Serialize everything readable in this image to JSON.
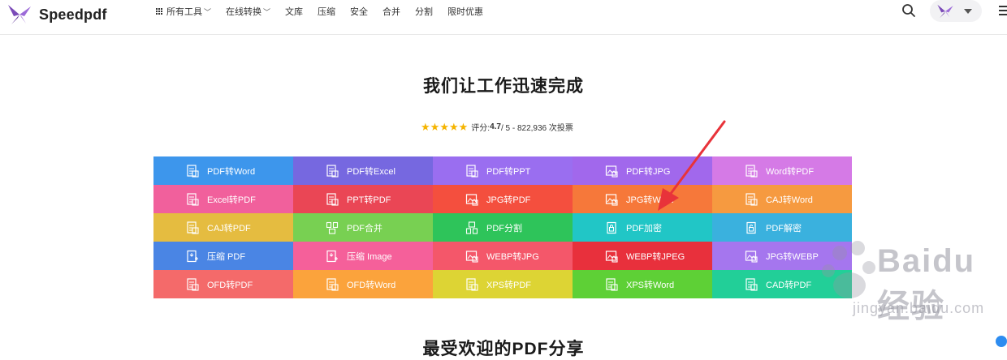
{
  "header": {
    "brand": "Speedpdf",
    "nav": [
      {
        "label": "所有工具",
        "has_grid_icon": true,
        "has_chevron": true
      },
      {
        "label": "在线转换",
        "has_chevron": true
      },
      {
        "label": "文库"
      },
      {
        "label": "压缩"
      },
      {
        "label": "安全"
      },
      {
        "label": "合并"
      },
      {
        "label": "分割"
      },
      {
        "label": "限时优惠"
      }
    ],
    "icons": [
      "search-icon",
      "avatar",
      "caret-down-icon",
      "menu-icon"
    ]
  },
  "hero": {
    "title": "我们让工作迅速完成",
    "rating_prefix": "评分: ",
    "rating_value": "4.7",
    "rating_suffix": " / 5 - 822,936 次投票",
    "stars": 5,
    "star_color": "#f5b400"
  },
  "tools": [
    {
      "label": "PDF转Word",
      "color": "#3d96ec",
      "icon": "document-icon"
    },
    {
      "label": "PDF转Excel",
      "color": "#7668e0",
      "icon": "document-icon"
    },
    {
      "label": "PDF转PPT",
      "color": "#9a6ef0",
      "icon": "document-icon"
    },
    {
      "label": "PDF转JPG",
      "color": "#a168ec",
      "icon": "image-icon"
    },
    {
      "label": "Word转PDF",
      "color": "#d57ae6",
      "icon": "document-icon"
    },
    {
      "label": "Excel转PDF",
      "color": "#f1609c",
      "icon": "document-icon"
    },
    {
      "label": "PPT转PDF",
      "color": "#ea4655",
      "icon": "document-icon"
    },
    {
      "label": "JPG转PDF",
      "color": "#f44f3e",
      "icon": "image-icon"
    },
    {
      "label": "JPG转Word",
      "color": "#f6783a",
      "icon": "image-icon"
    },
    {
      "label": "CAJ转Word",
      "color": "#f69a40",
      "icon": "document-icon"
    },
    {
      "label": "CAJ转PDF",
      "color": "#e5bc40",
      "icon": "document-icon"
    },
    {
      "label": "PDF合并",
      "color": "#78d052",
      "icon": "merge-icon"
    },
    {
      "label": "PDF分割",
      "color": "#2ec45a",
      "icon": "split-icon"
    },
    {
      "label": "PDF加密",
      "color": "#21c6c6",
      "icon": "lock-icon"
    },
    {
      "label": "PDF解密",
      "color": "#3ab1de",
      "icon": "unlock-icon"
    },
    {
      "label": "压缩 PDF",
      "color": "#4a85e4",
      "icon": "compress-icon"
    },
    {
      "label": "压缩 Image",
      "color": "#f5609a",
      "icon": "compress-icon"
    },
    {
      "label": "WEBP转JPG",
      "color": "#f4576a",
      "icon": "image-icon"
    },
    {
      "label": "WEBP转JPEG",
      "color": "#e8303c",
      "icon": "image-icon"
    },
    {
      "label": "JPG转WEBP",
      "color": "#a576ee",
      "icon": "image-icon"
    },
    {
      "label": "OFD转PDF",
      "color": "#f46a6a",
      "icon": "document-icon"
    },
    {
      "label": "OFD转Word",
      "color": "#fba33c",
      "icon": "document-icon"
    },
    {
      "label": "XPS转PDF",
      "color": "#ddd434",
      "icon": "document-icon"
    },
    {
      "label": "XPS转Word",
      "color": "#5ed036",
      "icon": "document-icon"
    },
    {
      "label": "CAD转PDF",
      "color": "#22cf98",
      "icon": "document-icon"
    }
  ],
  "section2_title": "最受欢迎的PDF分享",
  "watermark": {
    "main": "Baidu 经验",
    "sub": "jingyan.baidu.com"
  }
}
